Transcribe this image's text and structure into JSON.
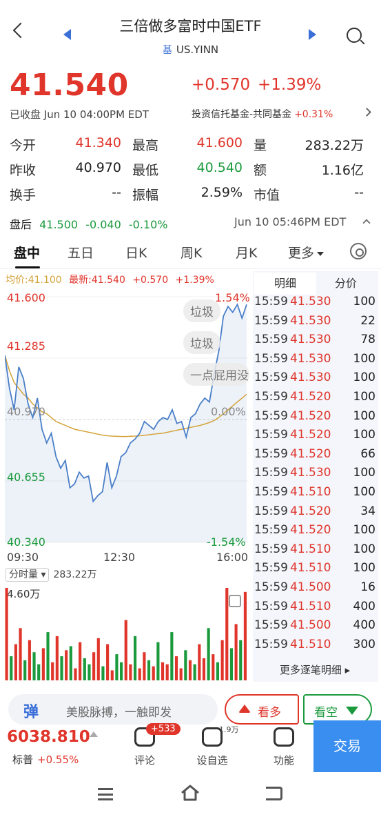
{
  "header": {
    "title": "三倍做多富时中国ETF",
    "tag": "基",
    "symbol": "US.YINN"
  },
  "quote": {
    "price": "41.540",
    "change": "+0.570",
    "change_pct": "+1.39%",
    "status": "已收盘 Jun 10 04:00PM EDT",
    "sector_name": "投资信托基金-共同基金",
    "sector_change": "+0.31%",
    "stats": [
      {
        "label": "今开",
        "value": "41.340",
        "color": "red"
      },
      {
        "label": "最高",
        "value": "41.600",
        "color": "red"
      },
      {
        "label": "量",
        "value": "283.22万",
        "color": "black"
      },
      {
        "label": "昨收",
        "value": "40.970",
        "color": "black"
      },
      {
        "label": "最低",
        "value": "40.540",
        "color": "green"
      },
      {
        "label": "额",
        "value": "1.16亿",
        "color": "black"
      },
      {
        "label": "换手",
        "value": "--",
        "color": "black"
      },
      {
        "label": "振幅",
        "value": "2.59%",
        "color": "black"
      },
      {
        "label": "市值",
        "value": "--",
        "color": "black"
      }
    ],
    "after_hours": {
      "label": "盘后",
      "price": "41.500",
      "change": "-0.040",
      "change_pct": "-0.10%",
      "time": "Jun 10 05:46PM EDT"
    }
  },
  "tabs": [
    "盘中",
    "五日",
    "日K",
    "周K",
    "月K",
    "更多"
  ],
  "legend": {
    "avg": "均价:41.100",
    "latest": "最新:41.540",
    "change": "+0.570",
    "change_pct": "+1.39%"
  },
  "danmaku": [
    "垃圾",
    "垃圾",
    "一点屁用没"
  ],
  "chart_data": {
    "type": "line",
    "y_labels": [
      "41.600",
      "41.285",
      "40.970",
      "40.655",
      "40.340"
    ],
    "pct_labels": [
      "1.54%",
      "0.00%",
      "-1.54%"
    ],
    "x_labels": [
      "09:30",
      "12:30",
      "16:00"
    ],
    "ylim": [
      40.34,
      41.6
    ],
    "prev_close": 40.97,
    "price": [
      41.3,
      41.13,
      41.02,
      41.24,
      41.18,
      41.05,
      40.98,
      41.08,
      40.92,
      40.85,
      40.9,
      40.78,
      40.72,
      40.76,
      40.62,
      40.64,
      40.7,
      40.67,
      40.68,
      40.55,
      40.58,
      40.6,
      40.75,
      40.62,
      40.68,
      40.78,
      40.8,
      40.85,
      40.87,
      40.9,
      40.96,
      40.94,
      40.92,
      40.96,
      40.98,
      40.97,
      41.02,
      40.95,
      40.96,
      40.88,
      40.98,
      41.0,
      41.05,
      41.08,
      41.06,
      41.2,
      41.32,
      41.5,
      41.55,
      41.52,
      41.56,
      41.49,
      41.56
    ],
    "avg": [
      41.3,
      41.22,
      41.16,
      41.13,
      41.1,
      41.08,
      41.05,
      41.03,
      41.01,
      41.0,
      40.98,
      40.96,
      40.95,
      40.94,
      40.93,
      40.92,
      40.915,
      40.91,
      40.905,
      40.9,
      40.895,
      40.89,
      40.887,
      40.885,
      40.884,
      40.883,
      40.883,
      40.884,
      40.885,
      40.887,
      40.889,
      40.892,
      40.895,
      40.898,
      40.9,
      40.905,
      40.91,
      40.915,
      40.92,
      40.925,
      40.93,
      40.935,
      40.94,
      40.947,
      40.955,
      40.965,
      40.98,
      41.0,
      41.02,
      41.04,
      41.06,
      41.08,
      41.1
    ],
    "volume_label": "分时量",
    "volume_total": "283.22万",
    "volume_max": "4.60万",
    "volume_colors": [
      "r",
      "g",
      "r",
      "r",
      "g",
      "r",
      "g",
      "g",
      "r",
      "g",
      "r",
      "r",
      "g",
      "r",
      "g",
      "r",
      "r",
      "g",
      "g",
      "r",
      "r",
      "g",
      "r",
      "r",
      "g",
      "g",
      "r",
      "r",
      "g",
      "r",
      "r",
      "g",
      "r",
      "g",
      "r",
      "r",
      "g",
      "r",
      "r",
      "g",
      "r",
      "g",
      "r",
      "r",
      "g",
      "r",
      "g",
      "r",
      "r",
      "g",
      "r",
      "g",
      "r"
    ],
    "volume": [
      46000,
      12000,
      18000,
      26000,
      10000,
      20000,
      14000,
      8000,
      16000,
      24000,
      9000,
      22000,
      12000,
      15000,
      17000,
      6000,
      19000,
      11000,
      8000,
      14000,
      21000,
      7000,
      18000,
      5000,
      13000,
      9000,
      30000,
      8000,
      22000,
      6000,
      14000,
      10000,
      7000,
      19000,
      9000,
      8000,
      24000,
      12000,
      6000,
      15000,
      10000,
      8000,
      18000,
      11000,
      26000,
      13000,
      9000,
      20000,
      46000,
      16000,
      28000,
      20000,
      44000
    ]
  },
  "detail_panel": {
    "tabs": [
      "明细",
      "分价"
    ],
    "ticks": [
      {
        "time": "15:59",
        "price": "41.530",
        "vol": "100"
      },
      {
        "time": "15:59",
        "price": "41.530",
        "vol": "22"
      },
      {
        "time": "15:59",
        "price": "41.530",
        "vol": "78"
      },
      {
        "time": "15:59",
        "price": "41.530",
        "vol": "100"
      },
      {
        "time": "15:59",
        "price": "41.530",
        "vol": "100"
      },
      {
        "time": "15:59",
        "price": "41.520",
        "vol": "100"
      },
      {
        "time": "15:59",
        "price": "41.520",
        "vol": "100"
      },
      {
        "time": "15:59",
        "price": "41.520",
        "vol": "100"
      },
      {
        "time": "15:59",
        "price": "41.520",
        "vol": "66"
      },
      {
        "time": "15:59",
        "price": "41.530",
        "vol": "100"
      },
      {
        "time": "15:59",
        "price": "41.510",
        "vol": "100"
      },
      {
        "time": "15:59",
        "price": "41.520",
        "vol": "34"
      },
      {
        "time": "15:59",
        "price": "41.520",
        "vol": "100"
      },
      {
        "time": "15:59",
        "price": "41.510",
        "vol": "100"
      },
      {
        "time": "15:59",
        "price": "41.510",
        "vol": "100"
      },
      {
        "time": "15:59",
        "price": "41.500",
        "vol": "16"
      },
      {
        "time": "15:59",
        "price": "41.510",
        "vol": "400"
      },
      {
        "time": "15:59",
        "price": "41.500",
        "vol": "400"
      },
      {
        "time": "15:59",
        "price": "41.510",
        "vol": "300"
      }
    ],
    "more": "更多逐笔明细"
  },
  "bottom": {
    "chat_logo": "弹",
    "chat_placeholder": "美股脉搏，一触即发",
    "bull": "看多",
    "bear": "看空",
    "index_value": "6038.810",
    "index_name": "标普",
    "index_change": "+0.55%",
    "comment": "评论",
    "comment_badge": "+533",
    "watch": "设自选",
    "watch_count": "1.9万",
    "function": "功能",
    "trade": "交易"
  },
  "colors": {
    "up": "#e0352b",
    "down": "#1a9a3c",
    "line": "#4a7fc8",
    "avg": "#d4a33a",
    "accent": "#3a8ef0"
  }
}
